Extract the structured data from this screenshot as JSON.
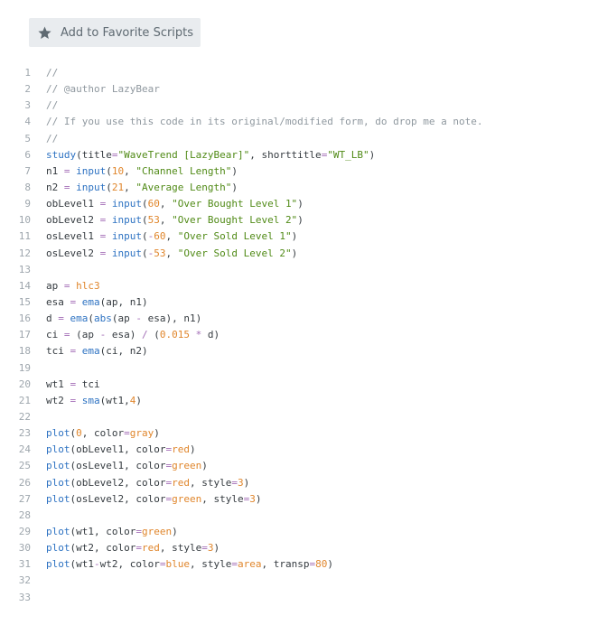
{
  "favorite_button": {
    "label": "Add to Favorite Scripts",
    "icon": "star-icon"
  },
  "colors": {
    "function": "#2d72c2",
    "string": "#508a16",
    "number": "#e0862c",
    "comment": "#8f989f",
    "operator": "#a36eb7",
    "text": "#353b40"
  },
  "code_lines": [
    {
      "n": "1",
      "tokens": [
        [
          "c",
          "//"
        ]
      ]
    },
    {
      "n": "2",
      "tokens": [
        [
          "c",
          "// @author LazyBear"
        ]
      ]
    },
    {
      "n": "3",
      "tokens": [
        [
          "c",
          "//"
        ]
      ]
    },
    {
      "n": "4",
      "tokens": [
        [
          "c",
          "// If you use this code in its original/modified form, do drop me a note."
        ]
      ]
    },
    {
      "n": "5",
      "tokens": [
        [
          "c",
          "//"
        ]
      ]
    },
    {
      "n": "6",
      "tokens": [
        [
          "f",
          "study"
        ],
        [
          "p",
          "(title"
        ],
        [
          "o",
          "="
        ],
        [
          "s",
          "\"WaveTrend [LazyBear]\""
        ],
        [
          "p",
          ", shorttitle"
        ],
        [
          "o",
          "="
        ],
        [
          "s",
          "\"WT_LB\""
        ],
        [
          "p",
          ")"
        ]
      ]
    },
    {
      "n": "7",
      "tokens": [
        [
          "p",
          "n1 "
        ],
        [
          "o",
          "="
        ],
        [
          "p",
          " "
        ],
        [
          "f",
          "input"
        ],
        [
          "p",
          "("
        ],
        [
          "n",
          "10"
        ],
        [
          "p",
          ", "
        ],
        [
          "s",
          "\"Channel Length\""
        ],
        [
          "p",
          ")"
        ]
      ]
    },
    {
      "n": "8",
      "tokens": [
        [
          "p",
          "n2 "
        ],
        [
          "o",
          "="
        ],
        [
          "p",
          " "
        ],
        [
          "f",
          "input"
        ],
        [
          "p",
          "("
        ],
        [
          "n",
          "21"
        ],
        [
          "p",
          ", "
        ],
        [
          "s",
          "\"Average Length\""
        ],
        [
          "p",
          ")"
        ]
      ]
    },
    {
      "n": "9",
      "tokens": [
        [
          "p",
          "obLevel1 "
        ],
        [
          "o",
          "="
        ],
        [
          "p",
          " "
        ],
        [
          "f",
          "input"
        ],
        [
          "p",
          "("
        ],
        [
          "n",
          "60"
        ],
        [
          "p",
          ", "
        ],
        [
          "s",
          "\"Over Bought Level 1\""
        ],
        [
          "p",
          ")"
        ]
      ]
    },
    {
      "n": "10",
      "tokens": [
        [
          "p",
          "obLevel2 "
        ],
        [
          "o",
          "="
        ],
        [
          "p",
          " "
        ],
        [
          "f",
          "input"
        ],
        [
          "p",
          "("
        ],
        [
          "n",
          "53"
        ],
        [
          "p",
          ", "
        ],
        [
          "s",
          "\"Over Bought Level 2\""
        ],
        [
          "p",
          ")"
        ]
      ]
    },
    {
      "n": "11",
      "tokens": [
        [
          "p",
          "osLevel1 "
        ],
        [
          "o",
          "="
        ],
        [
          "p",
          " "
        ],
        [
          "f",
          "input"
        ],
        [
          "p",
          "("
        ],
        [
          "o",
          "-"
        ],
        [
          "n",
          "60"
        ],
        [
          "p",
          ", "
        ],
        [
          "s",
          "\"Over Sold Level 1\""
        ],
        [
          "p",
          ")"
        ]
      ]
    },
    {
      "n": "12",
      "tokens": [
        [
          "p",
          "osLevel2 "
        ],
        [
          "o",
          "="
        ],
        [
          "p",
          " "
        ],
        [
          "f",
          "input"
        ],
        [
          "p",
          "("
        ],
        [
          "o",
          "-"
        ],
        [
          "n",
          "53"
        ],
        [
          "p",
          ", "
        ],
        [
          "s",
          "\"Over Sold Level 2\""
        ],
        [
          "p",
          ")"
        ]
      ]
    },
    {
      "n": "13",
      "tokens": []
    },
    {
      "n": "14",
      "tokens": [
        [
          "p",
          "ap "
        ],
        [
          "o",
          "="
        ],
        [
          "p",
          " "
        ],
        [
          "k",
          "hlc3"
        ]
      ]
    },
    {
      "n": "15",
      "tokens": [
        [
          "p",
          "esa "
        ],
        [
          "o",
          "="
        ],
        [
          "p",
          " "
        ],
        [
          "f",
          "ema"
        ],
        [
          "p",
          "(ap, n1)"
        ]
      ]
    },
    {
      "n": "16",
      "tokens": [
        [
          "p",
          "d "
        ],
        [
          "o",
          "="
        ],
        [
          "p",
          " "
        ],
        [
          "f",
          "ema"
        ],
        [
          "p",
          "("
        ],
        [
          "f",
          "abs"
        ],
        [
          "p",
          "(ap "
        ],
        [
          "o",
          "-"
        ],
        [
          "p",
          " esa), n1)"
        ]
      ]
    },
    {
      "n": "17",
      "tokens": [
        [
          "p",
          "ci "
        ],
        [
          "o",
          "="
        ],
        [
          "p",
          " (ap "
        ],
        [
          "o",
          "-"
        ],
        [
          "p",
          " esa) "
        ],
        [
          "o",
          "/"
        ],
        [
          "p",
          " ("
        ],
        [
          "n",
          "0.015"
        ],
        [
          "p",
          " "
        ],
        [
          "o",
          "*"
        ],
        [
          "p",
          " d)"
        ]
      ]
    },
    {
      "n": "18",
      "tokens": [
        [
          "p",
          "tci "
        ],
        [
          "o",
          "="
        ],
        [
          "p",
          " "
        ],
        [
          "f",
          "ema"
        ],
        [
          "p",
          "(ci, n2)"
        ]
      ]
    },
    {
      "n": "19",
      "tokens": []
    },
    {
      "n": "20",
      "tokens": [
        [
          "p",
          "wt1 "
        ],
        [
          "o",
          "="
        ],
        [
          "p",
          " tci"
        ]
      ]
    },
    {
      "n": "21",
      "tokens": [
        [
          "p",
          "wt2 "
        ],
        [
          "o",
          "="
        ],
        [
          "p",
          " "
        ],
        [
          "f",
          "sma"
        ],
        [
          "p",
          "(wt1,"
        ],
        [
          "n",
          "4"
        ],
        [
          "p",
          ")"
        ]
      ]
    },
    {
      "n": "22",
      "tokens": []
    },
    {
      "n": "23",
      "tokens": [
        [
          "f",
          "plot"
        ],
        [
          "p",
          "("
        ],
        [
          "n",
          "0"
        ],
        [
          "p",
          ", color"
        ],
        [
          "o",
          "="
        ],
        [
          "k",
          "gray"
        ],
        [
          "p",
          ")"
        ]
      ]
    },
    {
      "n": "24",
      "tokens": [
        [
          "f",
          "plot"
        ],
        [
          "p",
          "(obLevel1, color"
        ],
        [
          "o",
          "="
        ],
        [
          "k",
          "red"
        ],
        [
          "p",
          ")"
        ]
      ]
    },
    {
      "n": "25",
      "tokens": [
        [
          "f",
          "plot"
        ],
        [
          "p",
          "(osLevel1, color"
        ],
        [
          "o",
          "="
        ],
        [
          "k",
          "green"
        ],
        [
          "p",
          ")"
        ]
      ]
    },
    {
      "n": "26",
      "tokens": [
        [
          "f",
          "plot"
        ],
        [
          "p",
          "(obLevel2, color"
        ],
        [
          "o",
          "="
        ],
        [
          "k",
          "red"
        ],
        [
          "p",
          ", style"
        ],
        [
          "o",
          "="
        ],
        [
          "n",
          "3"
        ],
        [
          "p",
          ")"
        ]
      ]
    },
    {
      "n": "27",
      "tokens": [
        [
          "f",
          "plot"
        ],
        [
          "p",
          "(osLevel2, color"
        ],
        [
          "o",
          "="
        ],
        [
          "k",
          "green"
        ],
        [
          "p",
          ", style"
        ],
        [
          "o",
          "="
        ],
        [
          "n",
          "3"
        ],
        [
          "p",
          ")"
        ]
      ]
    },
    {
      "n": "28",
      "tokens": []
    },
    {
      "n": "29",
      "tokens": [
        [
          "f",
          "plot"
        ],
        [
          "p",
          "(wt1, color"
        ],
        [
          "o",
          "="
        ],
        [
          "k",
          "green"
        ],
        [
          "p",
          ")"
        ]
      ]
    },
    {
      "n": "30",
      "tokens": [
        [
          "f",
          "plot"
        ],
        [
          "p",
          "(wt2, color"
        ],
        [
          "o",
          "="
        ],
        [
          "k",
          "red"
        ],
        [
          "p",
          ", style"
        ],
        [
          "o",
          "="
        ],
        [
          "n",
          "3"
        ],
        [
          "p",
          ")"
        ]
      ]
    },
    {
      "n": "31",
      "tokens": [
        [
          "f",
          "plot"
        ],
        [
          "p",
          "(wt1"
        ],
        [
          "o",
          "-"
        ],
        [
          "p",
          "wt2, color"
        ],
        [
          "o",
          "="
        ],
        [
          "k",
          "blue"
        ],
        [
          "p",
          ", style"
        ],
        [
          "o",
          "="
        ],
        [
          "k",
          "area"
        ],
        [
          "p",
          ", transp"
        ],
        [
          "o",
          "="
        ],
        [
          "n",
          "80"
        ],
        [
          "p",
          ")"
        ]
      ]
    },
    {
      "n": "32",
      "tokens": []
    },
    {
      "n": "33",
      "tokens": []
    }
  ]
}
